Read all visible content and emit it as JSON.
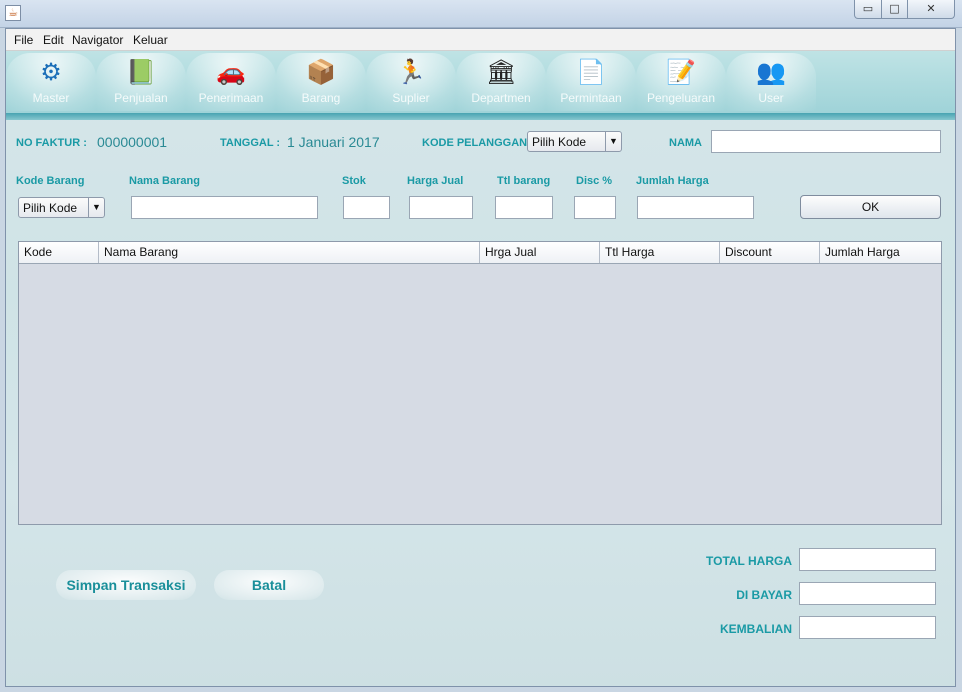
{
  "window": {
    "minimize_glyph": "▭",
    "maximize_glyph": "□",
    "close_glyph": "✕"
  },
  "menu": [
    "File",
    "Edit",
    "Navigator",
    "Keluar"
  ],
  "toolbar": [
    {
      "label": "Master",
      "icon": "gear-icon",
      "glyph": "⚙"
    },
    {
      "label": "Penjualan",
      "icon": "book-icon",
      "glyph": "📗"
    },
    {
      "label": "Penerimaan",
      "icon": "car-icon",
      "glyph": "🚗"
    },
    {
      "label": "Barang",
      "icon": "box-icon",
      "glyph": "📦"
    },
    {
      "label": "Suplier",
      "icon": "runner-icon",
      "glyph": "🏃"
    },
    {
      "label": "Departmen",
      "icon": "building-icon",
      "glyph": "🏛"
    },
    {
      "label": "Permintaan",
      "icon": "document-icon",
      "glyph": "📄"
    },
    {
      "label": "Pengeluaran",
      "icon": "notepad-icon",
      "glyph": "📝"
    },
    {
      "label": "User",
      "icon": "users-icon",
      "glyph": "👥"
    }
  ],
  "header": {
    "no_faktur_label": "NO FAKTUR :",
    "no_faktur_value": "000000001",
    "tanggal_label": "TANGGAL :",
    "tanggal_value": "1 Januari 2017",
    "kode_pelanggan_label": "KODE PELANGGAN",
    "kode_pelanggan_selected": "Pilih Kode",
    "nama_label": "NAMA",
    "nama_value": ""
  },
  "item_entry": {
    "kode_barang_label": "Kode Barang",
    "kode_barang_selected": "Pilih Kode",
    "nama_barang_label": "Nama Barang",
    "stok_label": "Stok",
    "harga_jual_label": "Harga Jual",
    "ttl_barang_label": "Ttl barang",
    "disc_label": "Disc %",
    "jumlah_harga_label": "Jumlah Harga",
    "ok_label": "OK"
  },
  "table": {
    "columns": [
      "Kode",
      "Nama Barang",
      "Hrga Jual",
      "Ttl Harga",
      "Discount",
      "Jumlah Harga"
    ],
    "rows": []
  },
  "actions": {
    "simpan_label": "Simpan Transaksi",
    "batal_label": "Batal"
  },
  "totals": {
    "total_harga_label": "TOTAL HARGA",
    "di_bayar_label": "DI BAYAR",
    "kembalian_label": "KEMBALIAN"
  },
  "colors": {
    "label_teal": "#1a9aa5",
    "toolbar_bg": "#a8d8dc"
  }
}
